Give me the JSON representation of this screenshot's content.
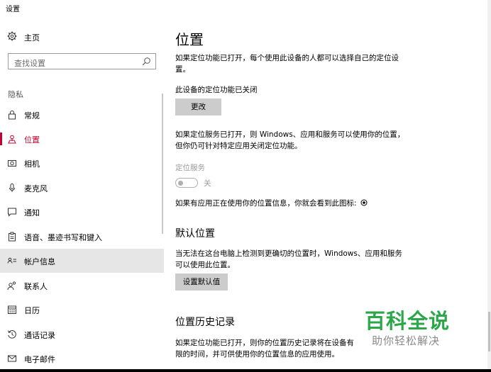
{
  "window": {
    "title": "设置"
  },
  "sidebar": {
    "home_label": "主页",
    "search_placeholder": "查找设置",
    "section_label": "隐私",
    "items": [
      {
        "label": "常规",
        "icon": "lock-icon"
      },
      {
        "label": "位置",
        "icon": "location-icon",
        "active": true
      },
      {
        "label": "相机",
        "icon": "camera-icon"
      },
      {
        "label": "麦克风",
        "icon": "microphone-icon"
      },
      {
        "label": "通知",
        "icon": "notification-icon"
      },
      {
        "label": "语音、墨迹书写和键入",
        "icon": "clipboard-icon"
      },
      {
        "label": "帐户信息",
        "icon": "account-info-icon",
        "hover": true
      },
      {
        "label": "联系人",
        "icon": "contacts-icon"
      },
      {
        "label": "日历",
        "icon": "calendar-icon"
      },
      {
        "label": "通话记录",
        "icon": "history-icon"
      },
      {
        "label": "电子邮件",
        "icon": "mail-icon"
      }
    ]
  },
  "main": {
    "title": "位置",
    "intro": "如果定位功能已打开，每个使用此设备的人都可以选择自己的定位设置。",
    "device_status": "此设备的定位功能已关闭",
    "change_button": "更改",
    "service_desc": "如果定位服务已打开，则 Windows、应用和服务可以使用你的位置，但你仍可针对特定应用关闭定位功能。",
    "service_label": "定位服务",
    "toggle_state": "关",
    "toggle_on": false,
    "icon_note": "如果有应用正在使用你的位置信息，你就会看到此图标:",
    "default_location": {
      "heading": "默认位置",
      "desc": "当无法在这台电脑上检测到更确切的位置时，Windows、应用和服务可以使用此位置。",
      "button": "设置默认值"
    },
    "history": {
      "heading": "位置历史记录",
      "desc": "如果定位功能已打开，则你的位置历史记录将在设备有限的时间，并可供使用你的位置信息的应用使用。"
    }
  },
  "watermark": {
    "big": "百科全说",
    "small": "助你轻松解决"
  },
  "colors": {
    "accent": "#c3002f",
    "watermark_green": "#2aa748",
    "button_bg": "#cccccc"
  }
}
